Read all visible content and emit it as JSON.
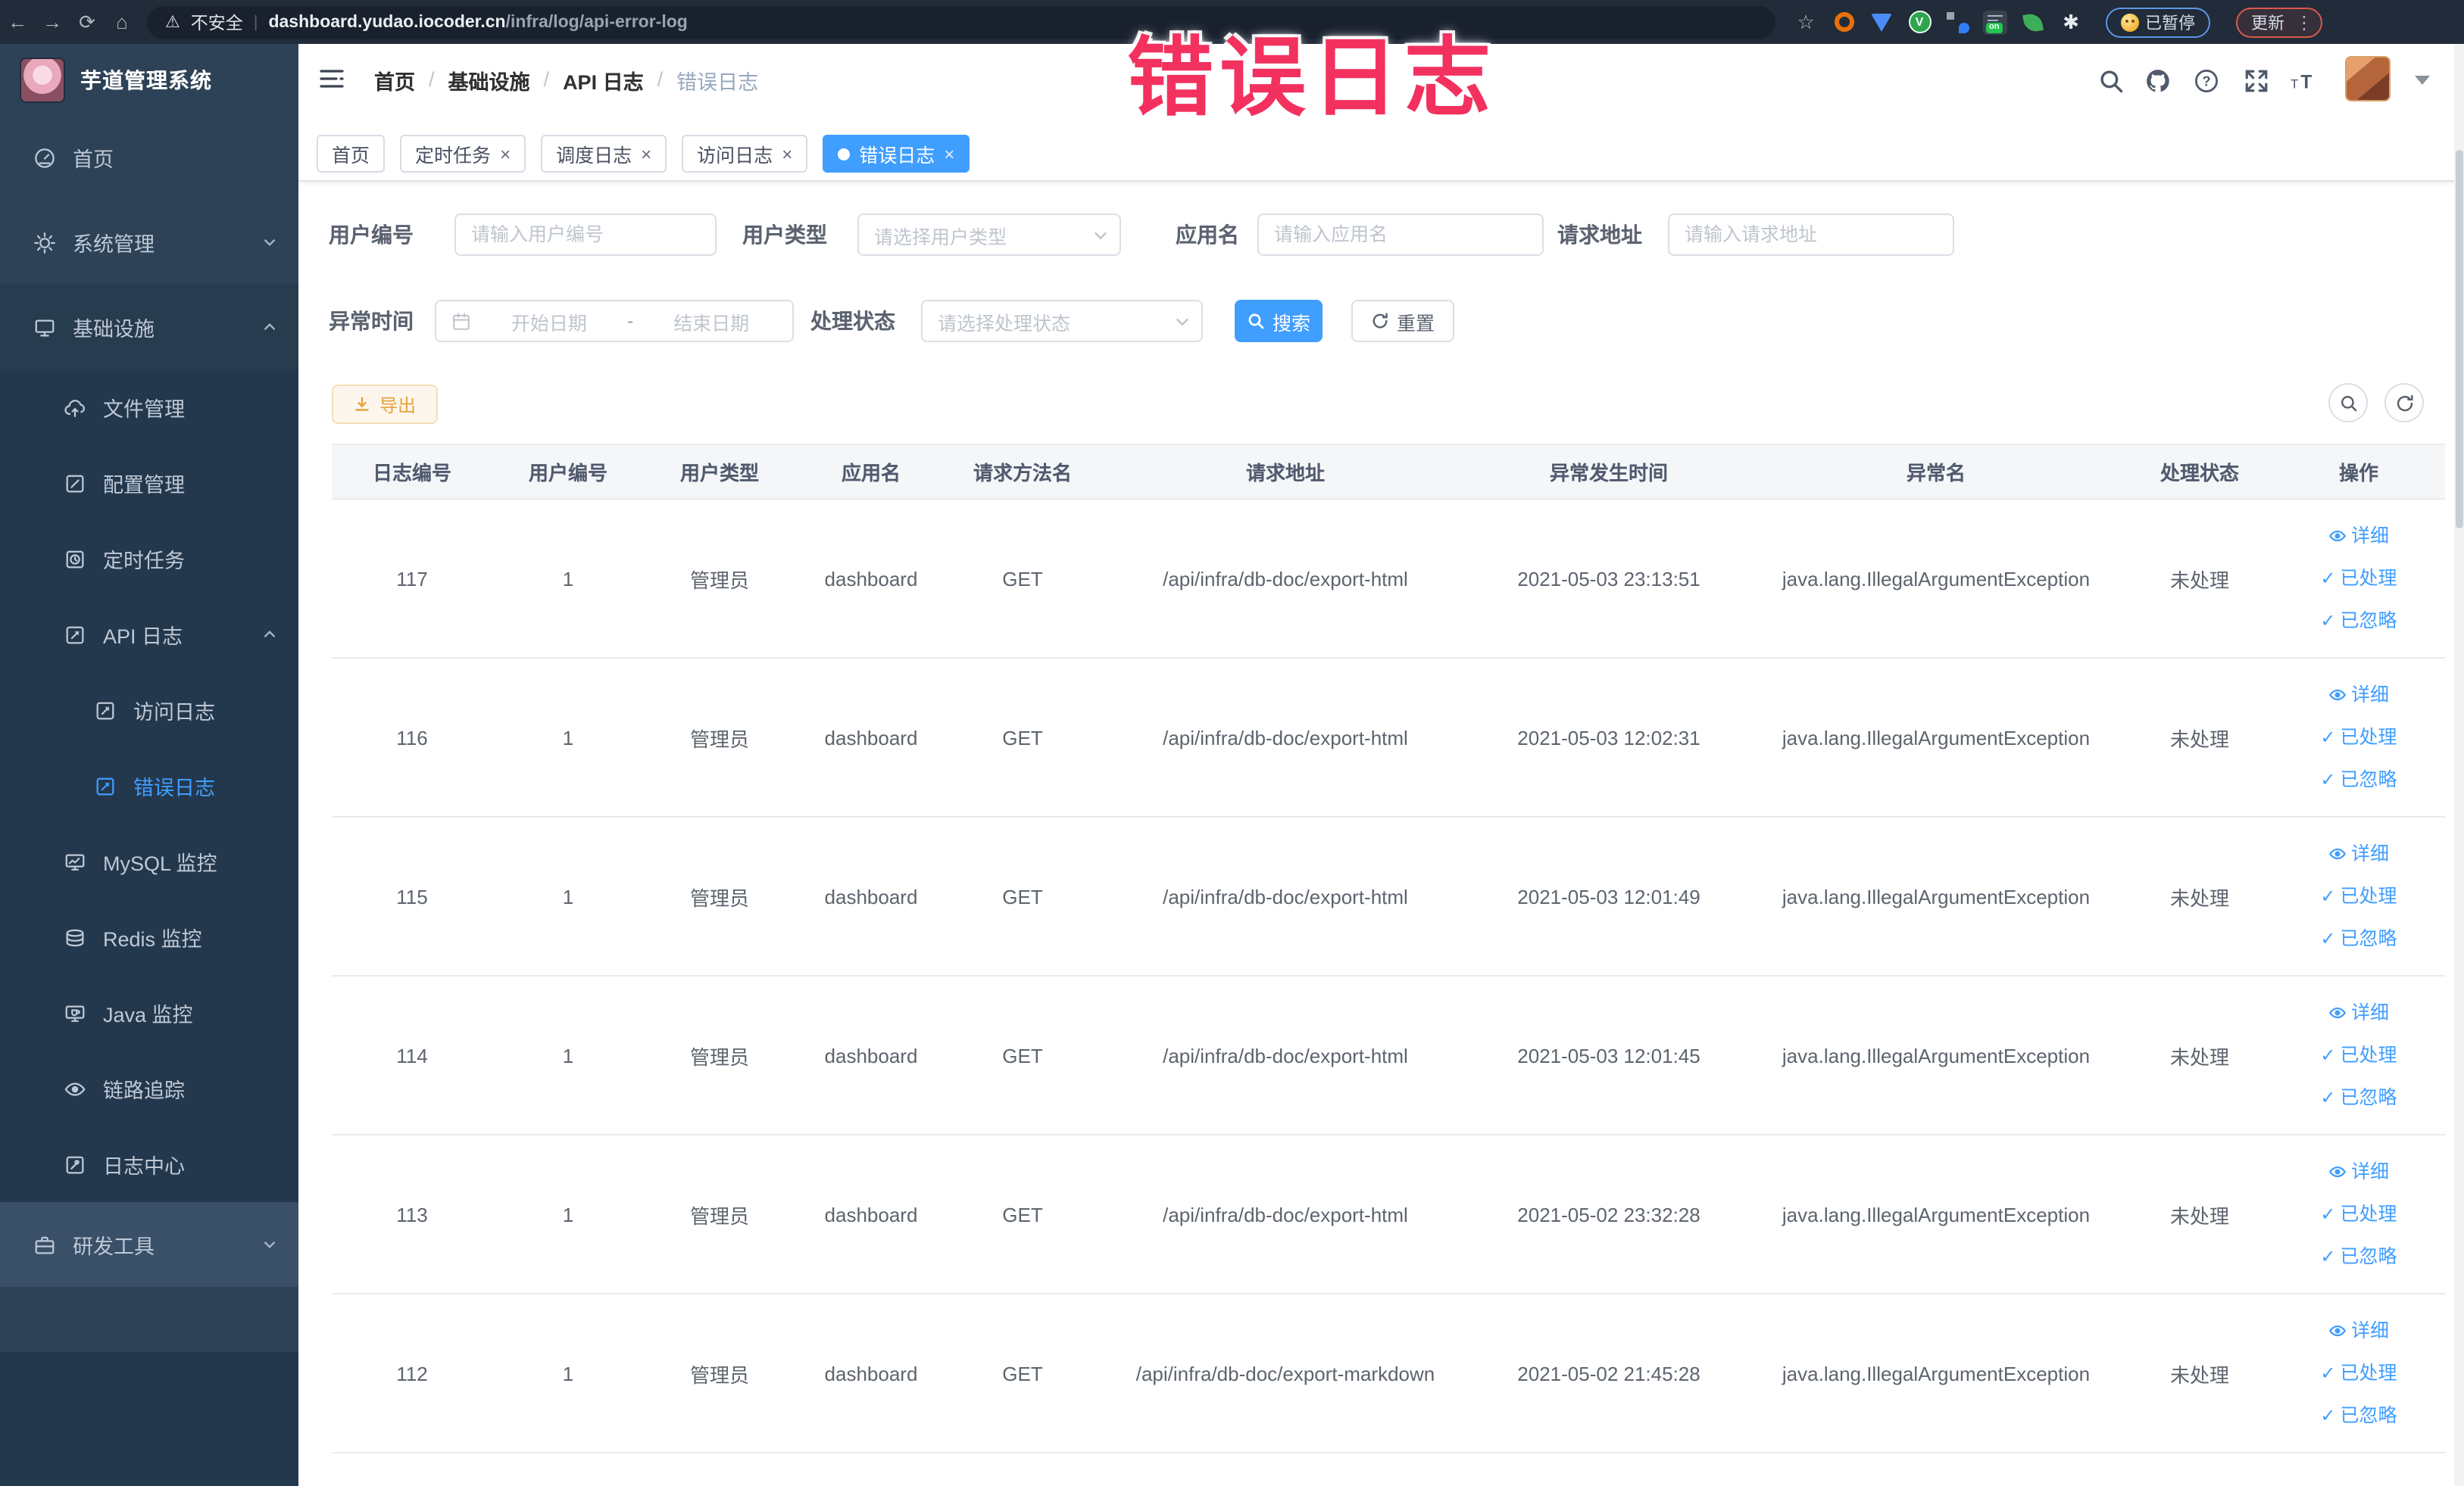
{
  "colors": {
    "accent": "#409eff",
    "annotation": "#f3315f",
    "warning": "#e6a23c",
    "sidebar_bg": "#2d4257",
    "submenu_bg": "#24384d"
  },
  "browser": {
    "security_label": "不安全",
    "url_host": "dashboard.yudao.iocoder.cn",
    "url_path": "/infra/log/api-error-log",
    "badges": {
      "paused": "已暂停",
      "update": "更新",
      "on": "on"
    }
  },
  "annotation": {
    "text": "错误日志"
  },
  "sidebar": {
    "app_title": "芋道管理系统",
    "items": [
      {
        "key": "home",
        "label": "首页",
        "icon": "home-icon",
        "level": 1
      },
      {
        "key": "system",
        "label": "系统管理",
        "icon": "gear-icon",
        "level": 1,
        "chevron": "down"
      },
      {
        "key": "infra",
        "label": "基础设施",
        "icon": "monitor-icon",
        "level": 1,
        "chevron": "up",
        "open": true
      },
      {
        "key": "file",
        "label": "文件管理",
        "icon": "cloud-upload-icon",
        "level": 2,
        "submenu": true
      },
      {
        "key": "config",
        "label": "配置管理",
        "icon": "edit-icon",
        "level": 2,
        "submenu": true
      },
      {
        "key": "job",
        "label": "定时任务",
        "icon": "timer-icon",
        "level": 2,
        "submenu": true
      },
      {
        "key": "api-log",
        "label": "API 日志",
        "icon": "log-icon",
        "level": 2,
        "submenu": true,
        "chevron": "up"
      },
      {
        "key": "access-log",
        "label": "访问日志",
        "icon": "log-icon",
        "level": 3,
        "submenu": true
      },
      {
        "key": "error-log",
        "label": "错误日志",
        "icon": "log-icon",
        "level": 3,
        "submenu": true,
        "active": true
      },
      {
        "key": "mysql",
        "label": "MySQL 监控",
        "icon": "mysql-monitor-icon",
        "level": 2,
        "submenu": true
      },
      {
        "key": "redis",
        "label": "Redis 监控",
        "icon": "redis-icon",
        "level": 2,
        "submenu": true
      },
      {
        "key": "java",
        "label": "Java 监控",
        "icon": "java-monitor-icon",
        "level": 2,
        "submenu": true
      },
      {
        "key": "trace",
        "label": "链路追踪",
        "icon": "eye-icon",
        "level": 2,
        "submenu": true
      },
      {
        "key": "log-center",
        "label": "日志中心",
        "icon": "log-center-icon",
        "level": 2,
        "submenu": true
      },
      {
        "key": "dev-tools",
        "label": "研发工具",
        "icon": "toolbox-icon",
        "level": 1,
        "chevron": "down",
        "highlight": true
      }
    ]
  },
  "header": {
    "breadcrumb": [
      "首页",
      "基础设施",
      "API 日志",
      "错误日志"
    ]
  },
  "tabs": [
    {
      "label": "首页",
      "closable": false,
      "active": false
    },
    {
      "label": "定时任务",
      "closable": true,
      "active": false
    },
    {
      "label": "调度日志",
      "closable": true,
      "active": false
    },
    {
      "label": "访问日志",
      "closable": true,
      "active": false
    },
    {
      "label": "错误日志",
      "closable": true,
      "active": true
    }
  ],
  "filters": {
    "user_id": {
      "label": "用户编号",
      "placeholder": "请输入用户编号"
    },
    "user_type": {
      "label": "用户类型",
      "placeholder": "请选择用户类型"
    },
    "app_name": {
      "label": "应用名",
      "placeholder": "请输入应用名"
    },
    "request_url": {
      "label": "请求地址",
      "placeholder": "请输入请求地址"
    },
    "exception_time": {
      "label": "异常时间",
      "start_placeholder": "开始日期",
      "separator": "-",
      "end_placeholder": "结束日期"
    },
    "process_status": {
      "label": "处理状态",
      "placeholder": "请选择处理状态"
    },
    "search_button": "搜索",
    "reset_button": "重置"
  },
  "toolbar": {
    "export_button": "导出"
  },
  "table": {
    "headers": [
      "日志编号",
      "用户编号",
      "用户类型",
      "应用名",
      "请求方法名",
      "请求地址",
      "异常发生时间",
      "异常名",
      "处理状态",
      "操作"
    ],
    "action_labels": {
      "detail": "详细",
      "processed": "已处理",
      "ignored": "已忽略"
    },
    "rows": [
      {
        "id": "117",
        "user_id": "1",
        "user_type": "管理员",
        "app": "dashboard",
        "method": "GET",
        "url": "/api/infra/db-doc/export-html",
        "time": "2021-05-03 23:13:51",
        "exception": "java.lang.IllegalArgumentException",
        "status": "未处理"
      },
      {
        "id": "116",
        "user_id": "1",
        "user_type": "管理员",
        "app": "dashboard",
        "method": "GET",
        "url": "/api/infra/db-doc/export-html",
        "time": "2021-05-03 12:02:31",
        "exception": "java.lang.IllegalArgumentException",
        "status": "未处理"
      },
      {
        "id": "115",
        "user_id": "1",
        "user_type": "管理员",
        "app": "dashboard",
        "method": "GET",
        "url": "/api/infra/db-doc/export-html",
        "time": "2021-05-03 12:01:49",
        "exception": "java.lang.IllegalArgumentException",
        "status": "未处理"
      },
      {
        "id": "114",
        "user_id": "1",
        "user_type": "管理员",
        "app": "dashboard",
        "method": "GET",
        "url": "/api/infra/db-doc/export-html",
        "time": "2021-05-03 12:01:45",
        "exception": "java.lang.IllegalArgumentException",
        "status": "未处理"
      },
      {
        "id": "113",
        "user_id": "1",
        "user_type": "管理员",
        "app": "dashboard",
        "method": "GET",
        "url": "/api/infra/db-doc/export-html",
        "time": "2021-05-02 23:32:28",
        "exception": "java.lang.IllegalArgumentException",
        "status": "未处理"
      },
      {
        "id": "112",
        "user_id": "1",
        "user_type": "管理员",
        "app": "dashboard",
        "method": "GET",
        "url": "/api/infra/db-doc/export-markdown",
        "time": "2021-05-02 21:45:28",
        "exception": "java.lang.IllegalArgumentException",
        "status": "未处理"
      }
    ]
  }
}
